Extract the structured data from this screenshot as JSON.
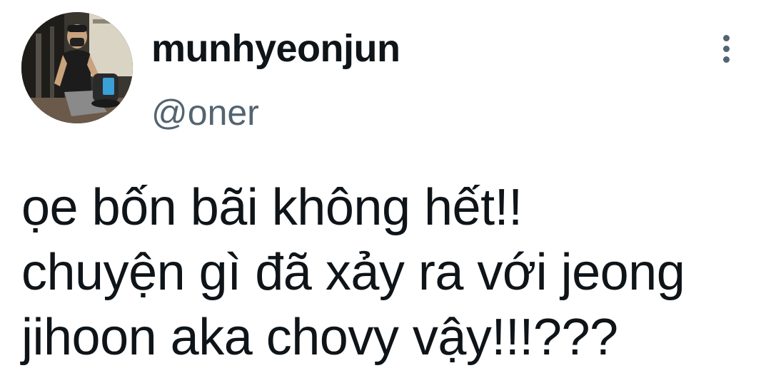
{
  "author": {
    "display_name": "munhyeonjun",
    "handle": "@oner",
    "avatar_icon": "profile-photo-avatar"
  },
  "menu": {
    "icon": "more-vertical-icon"
  },
  "tweet": {
    "lines": [
      "ọe bốn bãi không hết!!",
      "chuyện gì đã xảy ra với jeong",
      "jihoon aka chovy vậy!!!???"
    ]
  },
  "colors": {
    "text": "#0f1419",
    "secondary": "#536471",
    "background": "#ffffff"
  }
}
